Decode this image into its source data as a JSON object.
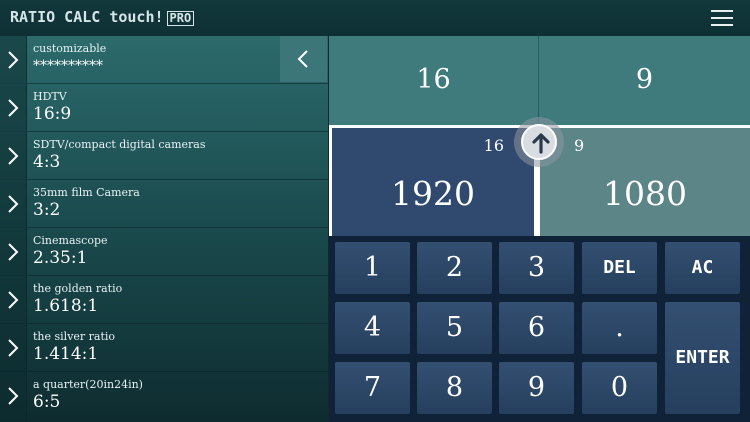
{
  "header": {
    "title": "RATIO CALC touch!",
    "badge": "PRO",
    "menu_icon": "hamburger-menu-icon"
  },
  "sidebar": {
    "collapse_icon": "chevron-left-icon",
    "items": [
      {
        "name": "customizable",
        "ratio": "**********"
      },
      {
        "name": "HDTV",
        "ratio": "16:9"
      },
      {
        "name": "SDTV/compact digital cameras",
        "ratio": "4:3"
      },
      {
        "name": "35mm film Camera",
        "ratio": "3:2"
      },
      {
        "name": "Cinemascope",
        "ratio": "2.35:1"
      },
      {
        "name": "the golden ratio",
        "ratio": "1.618:1"
      },
      {
        "name": "the silver ratio",
        "ratio": "1.414:1"
      },
      {
        "name": "a quarter(20in24in)",
        "ratio": "6:5"
      }
    ]
  },
  "ratio": {
    "left": "16",
    "right": "9"
  },
  "values": {
    "left_small": "16",
    "left": "1920",
    "right_small": "9",
    "right": "1080",
    "swap_icon": "arrow-up-icon"
  },
  "keypad": {
    "k1": "1",
    "k2": "2",
    "k3": "3",
    "del": "DEL",
    "ac": "AC",
    "k4": "4",
    "k5": "5",
    "k6": "6",
    "dot": ".",
    "k7": "7",
    "k8": "8",
    "k9": "9",
    "k0": "0",
    "enter": "ENTER"
  },
  "colors": {
    "accent": "#3f7a7c",
    "keypad_bg": "#0f2238",
    "key": "#2f4a6e"
  }
}
